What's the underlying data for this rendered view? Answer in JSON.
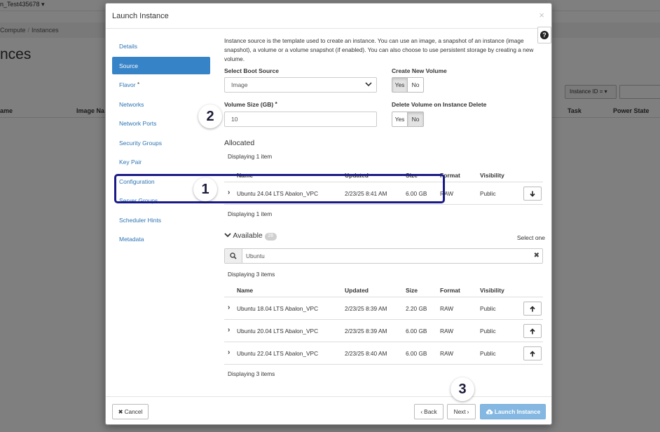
{
  "background": {
    "project": "n_Test435678 ▾",
    "breadcrumb": [
      "Compute",
      "Instances"
    ],
    "title": "nces",
    "filter_label": "Instance ID = ▾",
    "columns": [
      "ame",
      "Image Na",
      "Task",
      "Power State"
    ]
  },
  "modal": {
    "title": "Launch Instance",
    "close": "×",
    "help": "?",
    "nav": [
      {
        "label": "Details",
        "required": false
      },
      {
        "label": "Source",
        "required": false,
        "active": true
      },
      {
        "label": "Flavor",
        "required": true
      },
      {
        "label": "Networks",
        "required": false
      },
      {
        "label": "Network Ports",
        "required": false
      },
      {
        "label": "Security Groups",
        "required": false
      },
      {
        "label": "Key Pair",
        "required": false
      },
      {
        "label": "Configuration",
        "required": false
      },
      {
        "label": "Server Groups",
        "required": false
      },
      {
        "label": "Scheduler Hints",
        "required": false
      },
      {
        "label": "Metadata",
        "required": false
      }
    ],
    "required_mark": "*",
    "intro": "Instance source is the template used to create an instance. You can use an image, a snapshot of an instance (image snapshot), a volume or a volume snapshot (if enabled). You can also choose to use persistent storage by creating a new volume.",
    "boot_source": {
      "label": "Select Boot Source",
      "value": "Image"
    },
    "create_volume": {
      "label": "Create New Volume",
      "yes": "Yes",
      "no": "No",
      "selected": "Yes"
    },
    "volume_size": {
      "label": "Volume Size (GB)",
      "value": "10"
    },
    "delete_volume": {
      "label": "Delete Volume on Instance Delete",
      "yes": "Yes",
      "no": "No",
      "selected": "No"
    },
    "allocated": {
      "title": "Allocated",
      "displaying_top": "Displaying 1 item",
      "displaying_bottom": "Displaying 1 item",
      "rows": [
        {
          "name": "Ubuntu 24.04 LTS Abalon_VPC",
          "updated": "2/23/25 8:41 AM",
          "size": "6.00 GB",
          "format": "RAW",
          "visibility": "Public",
          "action_icon": "arrow-down-icon"
        }
      ]
    },
    "columns": {
      "name": "Name",
      "updated": "Updated",
      "size": "Size",
      "format": "Format",
      "visibility": "Visibility"
    },
    "available": {
      "title": "Available",
      "count": "28",
      "select_one": "Select one",
      "search_value": "Ubuntu",
      "displaying_top": "Displaying 3 items",
      "displaying_bottom": "Displaying 3 items",
      "rows": [
        {
          "name": "Ubuntu 18.04 LTS Abalon_VPC",
          "updated": "2/23/25 8:39 AM",
          "size": "2.20 GB",
          "format": "RAW",
          "visibility": "Public",
          "action_icon": "arrow-up-icon"
        },
        {
          "name": "Ubuntu 20.04 LTS Abalon_VPC",
          "updated": "2/23/25 8:39 AM",
          "size": "6.00 GB",
          "format": "RAW",
          "visibility": "Public",
          "action_icon": "arrow-up-icon"
        },
        {
          "name": "Ubuntu 22.04 LTS Abalon_VPC",
          "updated": "2/23/25 8:40 AM",
          "size": "6.00 GB",
          "format": "RAW",
          "visibility": "Public",
          "action_icon": "arrow-up-icon"
        }
      ]
    },
    "footer": {
      "cancel": "Cancel",
      "back": "Back",
      "next": "Next",
      "launch": "Launch Instance"
    }
  },
  "callouts": {
    "one": "1",
    "two": "2",
    "three": "3"
  },
  "colors": {
    "accent": "#3783c8",
    "highlight": "#1a1a86",
    "launch_button": "#84b8e2"
  }
}
